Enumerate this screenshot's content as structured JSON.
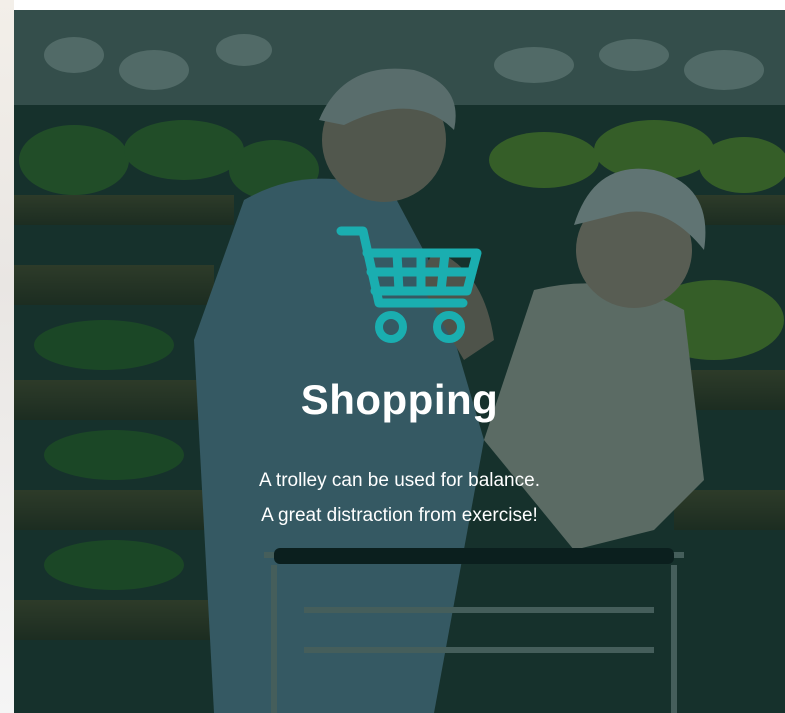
{
  "hero": {
    "icon": "shopping-cart-icon",
    "accent_color": "#1aaeb0",
    "title": "Shopping",
    "line1": "A trolley can be used for balance.",
    "line2": "A great distraction from exercise!"
  }
}
